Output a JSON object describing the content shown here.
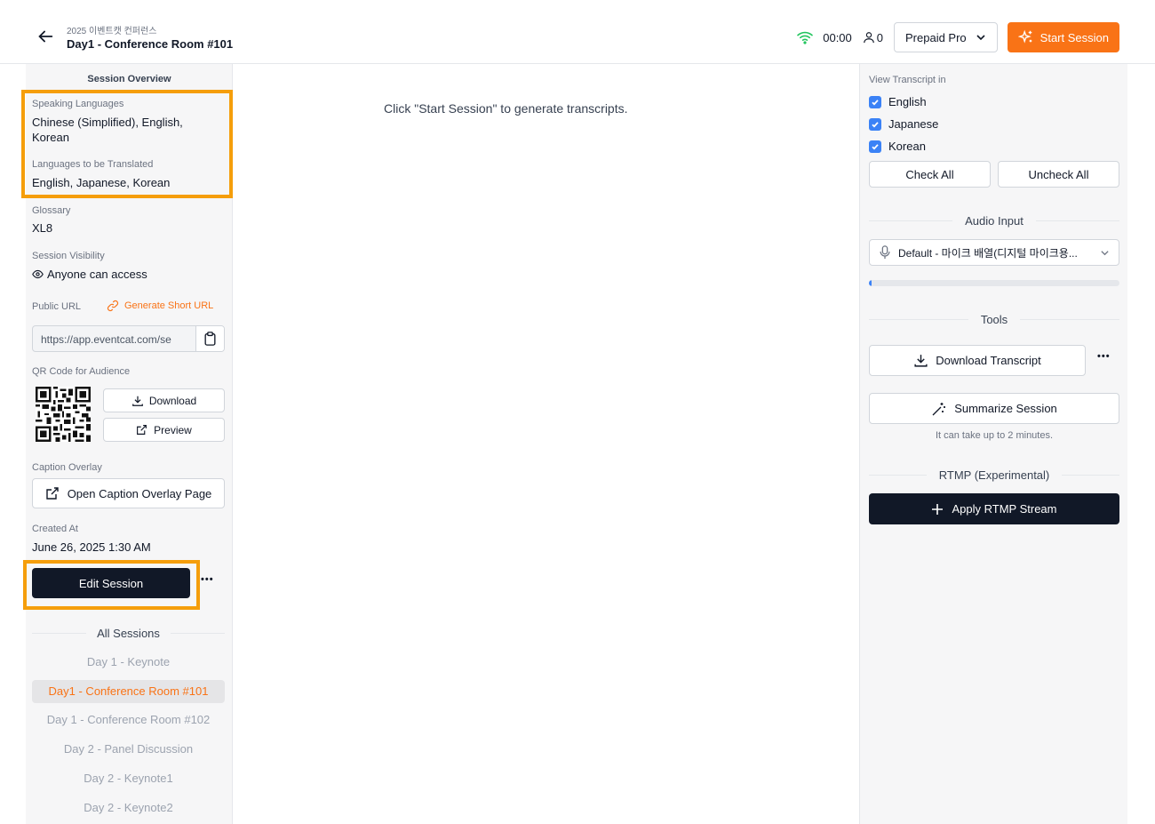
{
  "header": {
    "subtitle": "2025 이벤트캣 컨퍼런스",
    "title": "Day1 - Conference Room #101",
    "timer": "00:00",
    "listener_count": "0",
    "plan_label": "Prepaid Pro",
    "start_button": "Start Session"
  },
  "overview": {
    "heading": "Session Overview",
    "speaking_label": "Speaking Languages",
    "speaking_value": "Chinese (Simplified), English, Korean",
    "translated_label": "Languages to be Translated",
    "translated_value": "English, Japanese, Korean",
    "glossary_label": "Glossary",
    "glossary_value": "XL8",
    "visibility_label": "Session Visibility",
    "visibility_value": "Anyone can access",
    "public_url_label": "Public URL",
    "short_url_link": "Generate Short URL",
    "public_url_value": "https://app.eventcat.com/se",
    "qr_label": "QR Code for Audience",
    "download_label": "Download",
    "preview_label": "Preview",
    "caption_label": "Caption Overlay",
    "caption_button": "Open Caption Overlay Page",
    "created_label": "Created At",
    "created_value": "June 26, 2025 1:30 AM",
    "edit_button": "Edit Session",
    "more": "•••"
  },
  "sessions": {
    "heading": "All Sessions",
    "items": [
      "Day 1 - Keynote",
      "Day1 - Conference Room #101",
      "Day 1 - Conference Room #102",
      "Day 2 - Panel Discussion",
      "Day 2 - Keynote1",
      "Day 2 - Keynote2"
    ],
    "active_index": 1
  },
  "main": {
    "placeholder": "Click \"Start Session\" to generate transcripts."
  },
  "right": {
    "transcript_heading": "View Transcript in",
    "languages": [
      {
        "label": "English",
        "checked": true
      },
      {
        "label": "Japanese",
        "checked": true
      },
      {
        "label": "Korean",
        "checked": true
      }
    ],
    "check_all": "Check All",
    "uncheck_all": "Uncheck All",
    "audio_heading": "Audio Input",
    "audio_device": "Default - 마이크 배열(디지털 마이크용...",
    "audio_level": 0.01,
    "tools_heading": "Tools",
    "download_transcript": "Download Transcript",
    "more": "•••",
    "summarize": "Summarize Session",
    "summarize_note": "It can take up to 2 minutes.",
    "rtmp_heading": "RTMP (Experimental)",
    "rtmp_button": "Apply RTMP Stream"
  },
  "colors": {
    "accent": "#f97316",
    "highlight_border": "#f59e0b",
    "dark": "#111827",
    "check": "#3b82f6",
    "wifi": "#22c55e"
  }
}
